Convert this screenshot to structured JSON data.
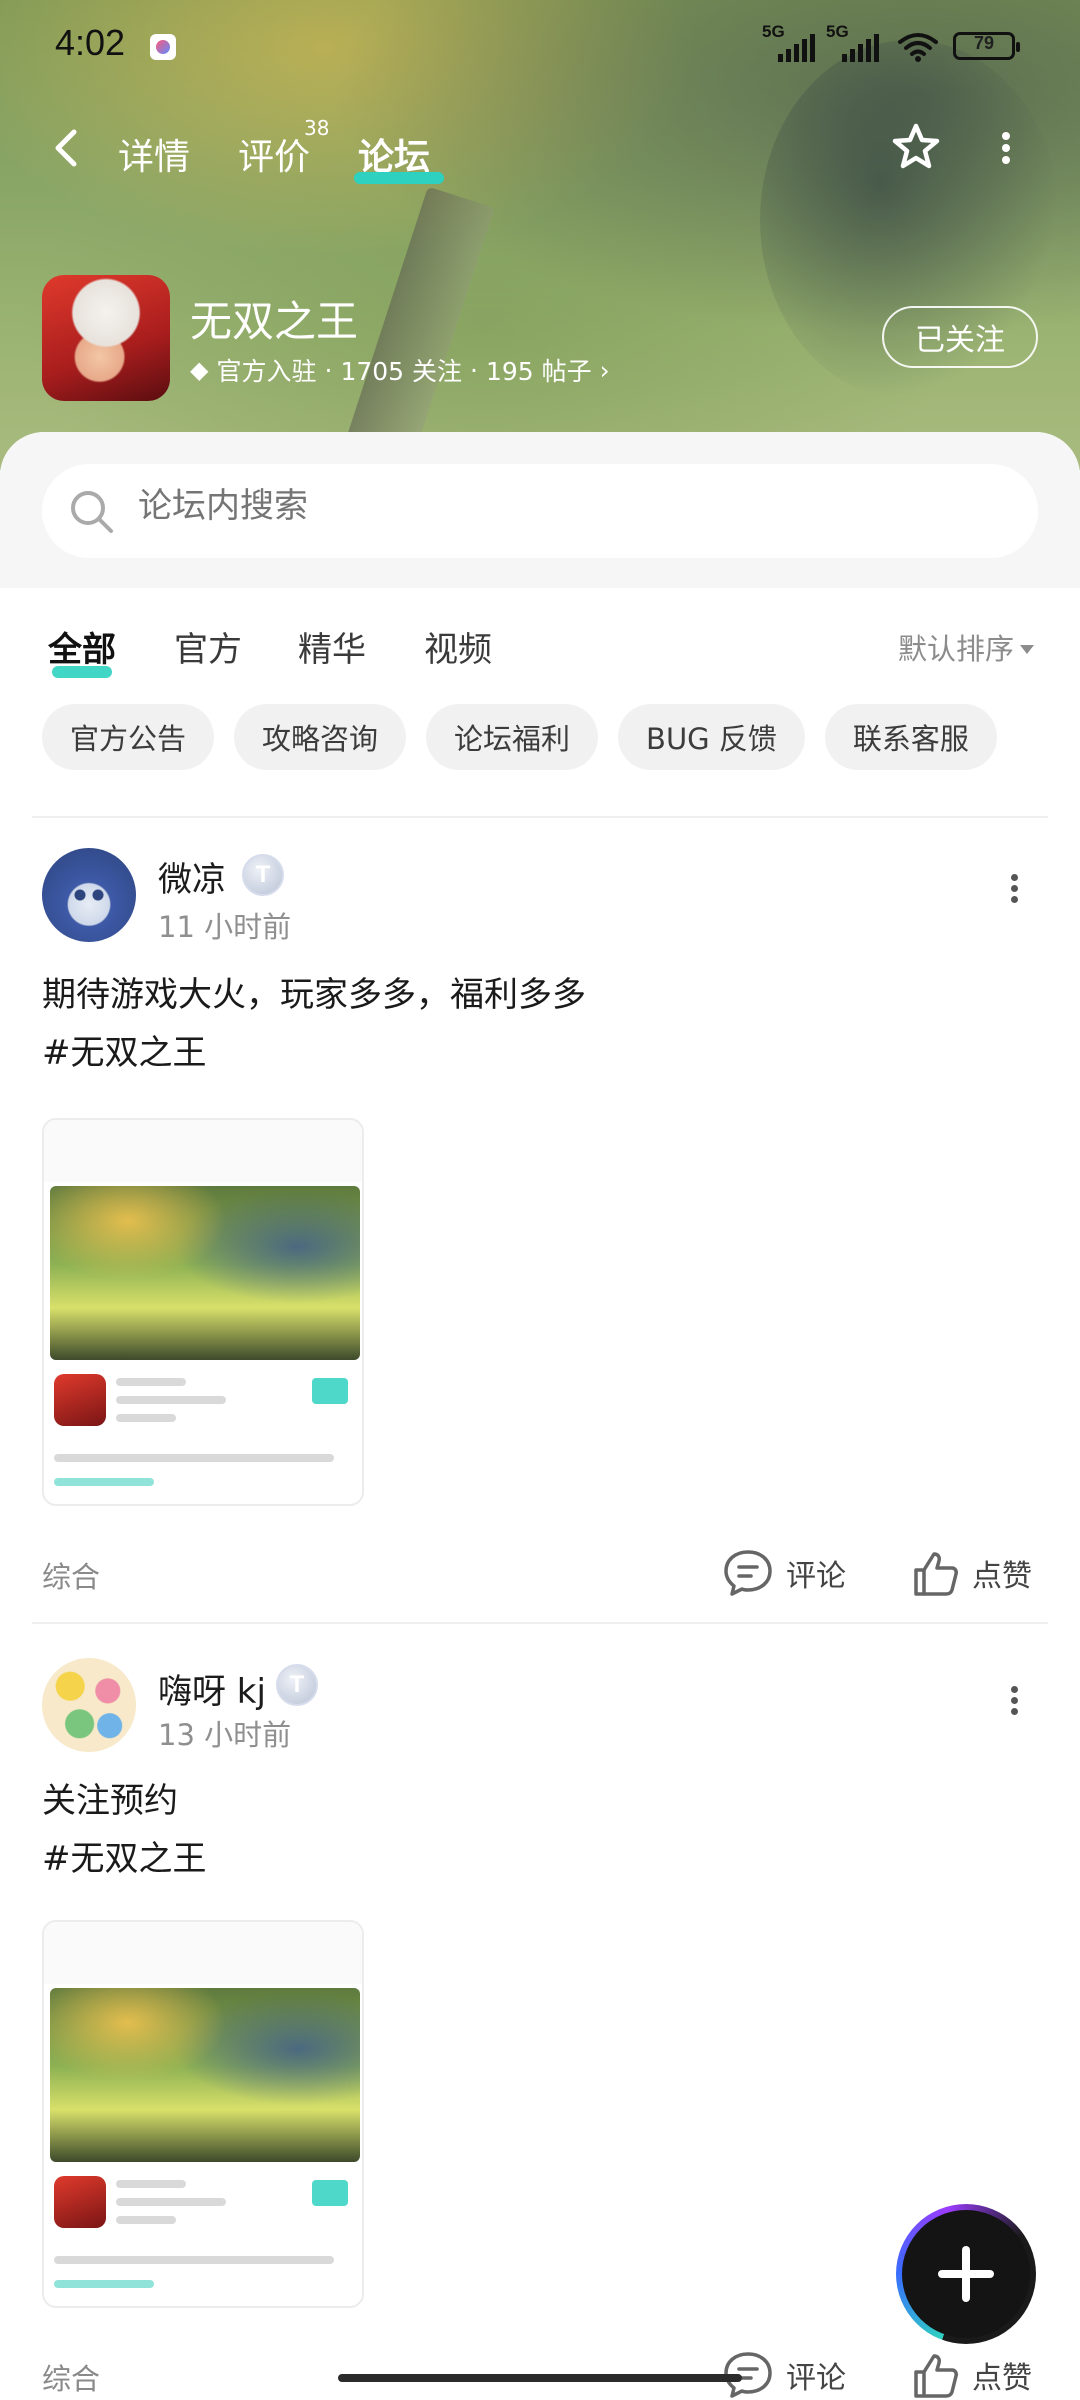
{
  "status_bar": {
    "time": "4:02",
    "signal1_label": "5G",
    "signal2_label": "5G",
    "battery": "79"
  },
  "nav": {
    "tabs": [
      {
        "label": "详情"
      },
      {
        "label": "评价",
        "badge": "38"
      },
      {
        "label": "论坛",
        "active": true
      }
    ],
    "accent": "#2ed1c0"
  },
  "game": {
    "title": "无双之王",
    "official": "官方入驻",
    "followers": "1705 关注",
    "posts": "195 帖子",
    "follow_button": "已关注"
  },
  "search": {
    "placeholder": "论坛内搜索"
  },
  "filters": {
    "tabs": [
      "全部",
      "官方",
      "精华",
      "视频"
    ],
    "sort": "默认排序"
  },
  "chips": [
    "官方公告",
    "攻略咨询",
    "论坛福利",
    "BUG 反馈",
    "联系客服"
  ],
  "posts": [
    {
      "user": "微凉",
      "level": "T",
      "time": "11 小时前",
      "text_line1": "期待游戏大火，玩家多多，福利多多",
      "text_line2": "#无双之王",
      "category": "综合",
      "comment": "评论",
      "like": "点赞"
    },
    {
      "user": "嗨呀 kj",
      "level": "T",
      "time": "13 小时前",
      "text_line1": "关注预约",
      "text_line2": "#无双之王",
      "category": "综合",
      "comment": "评论",
      "like": "点赞"
    }
  ]
}
